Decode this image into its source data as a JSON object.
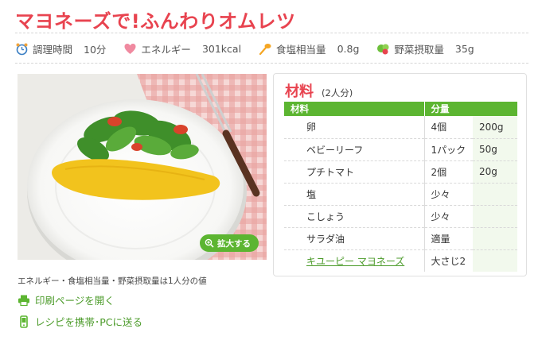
{
  "recipe": {
    "title": "マヨネーズで!ふんわりオムレツ"
  },
  "stats": [
    {
      "icon": "alarm-clock-icon",
      "label": "調理時間",
      "value": "10分"
    },
    {
      "icon": "heart-icon",
      "label": "エネルギー",
      "value": "301kcal"
    },
    {
      "icon": "salt-spoon-icon",
      "label": "食塩相当量",
      "value": "0.8g"
    },
    {
      "icon": "vegetables-icon",
      "label": "野菜摂取量",
      "value": "35g"
    }
  ],
  "photo": {
    "zoom_label": "拡大する"
  },
  "notes": {
    "nutrition_note": "エネルギー・食塩相当量・野菜摂取量は1人分の値",
    "print_link": "印刷ページを開く",
    "send_link": "レシピを携帯･PCに送る"
  },
  "ingredients": {
    "title": "材料",
    "servings": "(2人分)",
    "col_name": "材料",
    "col_amount": "分量",
    "items": [
      {
        "name": "卵",
        "qty": "4個",
        "grams": "200g",
        "link": false
      },
      {
        "name": "ベビーリーフ",
        "qty": "1パック",
        "grams": "50g",
        "link": false
      },
      {
        "name": "プチトマト",
        "qty": "2個",
        "grams": "20g",
        "link": false
      },
      {
        "name": "塩",
        "qty": "少々",
        "grams": "",
        "link": false
      },
      {
        "name": "こしょう",
        "qty": "少々",
        "grams": "",
        "link": false
      },
      {
        "name": "サラダ油",
        "qty": "適量",
        "grams": "",
        "link": false
      },
      {
        "name": "キユーピー マヨネーズ",
        "qty": "大さじ2",
        "grams": "",
        "link": true
      }
    ]
  },
  "colors": {
    "accent_red": "#e8434f",
    "accent_green": "#5cb531",
    "link_green": "#4a9a28"
  }
}
